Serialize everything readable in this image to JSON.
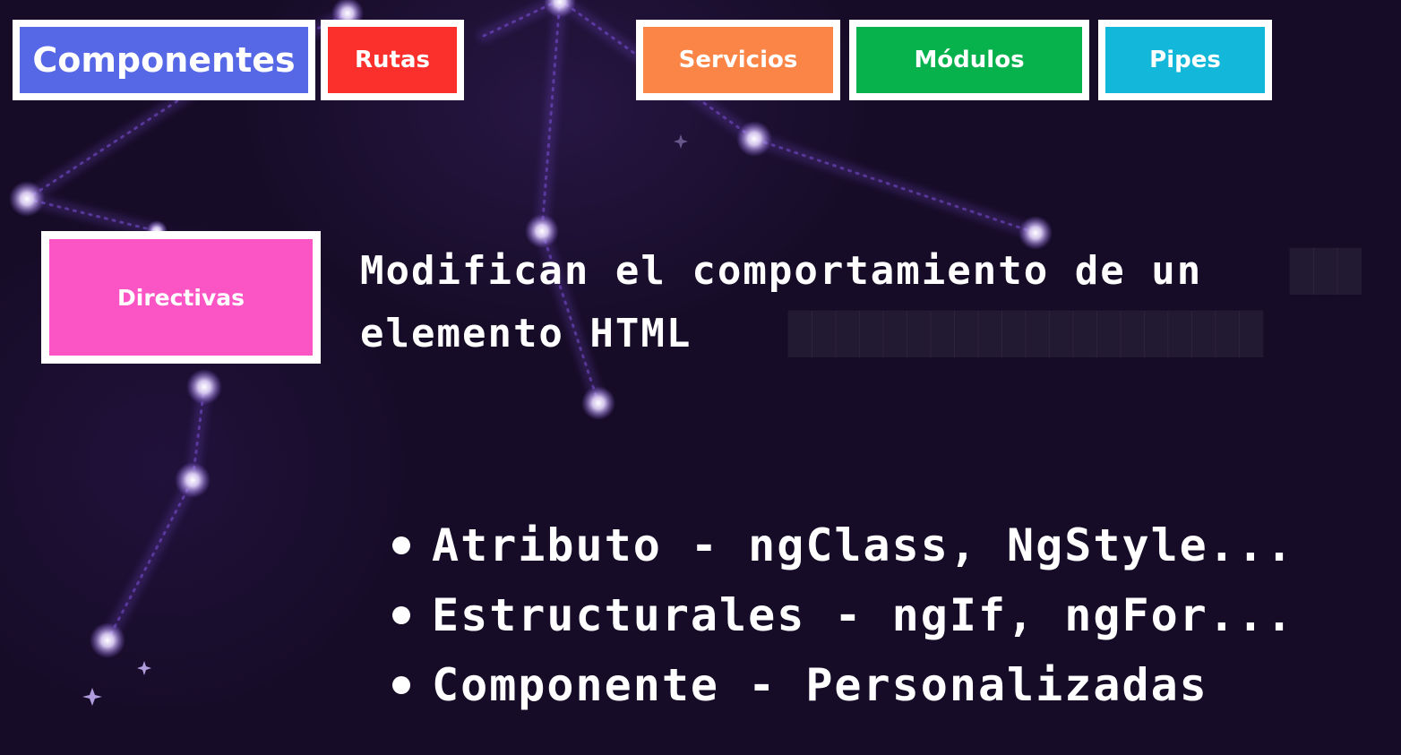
{
  "nav": {
    "tabs": [
      {
        "label": "Componentes",
        "color": "#5668e6"
      },
      {
        "label": "Rutas",
        "color": "#fb2f2c"
      },
      {
        "label": "Servicios",
        "color": "#fb8547"
      },
      {
        "label": "Módulos",
        "color": "#07b24d"
      },
      {
        "label": "Pipes",
        "color": "#13b7d9"
      }
    ]
  },
  "topic": {
    "label": "Directivas",
    "color": "#fb54c4"
  },
  "definition": {
    "text": "Modifican el comportamiento de un elemento HTML"
  },
  "types": [
    "Atributo - ngClass, NgStyle...",
    "Estructurales - ngIf, ngFor...",
    "Componente - Personalizadas"
  ],
  "theme": {
    "background": "#160c27",
    "star_color": "#ffffff",
    "trail_color": "#7b4fd6"
  }
}
